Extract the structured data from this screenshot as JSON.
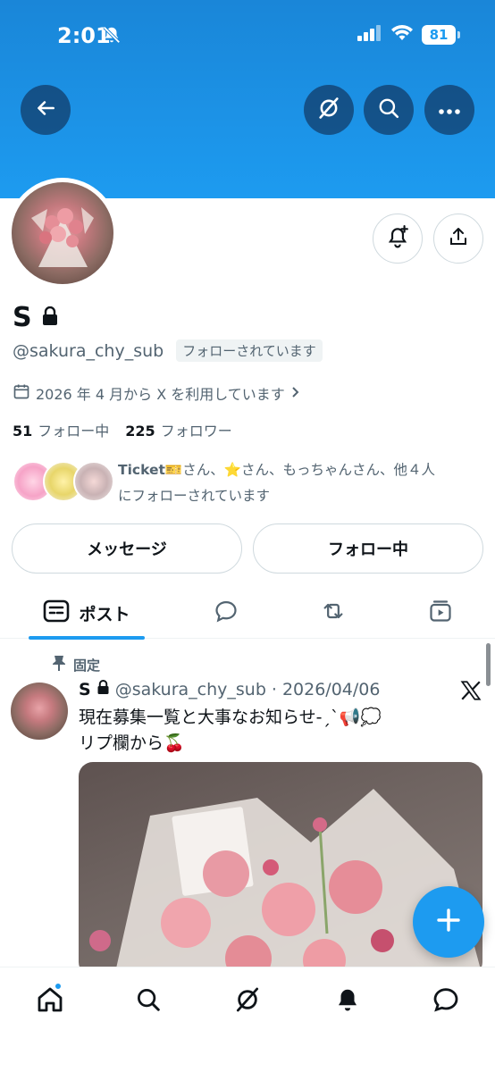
{
  "status_bar": {
    "time": "2:01",
    "battery": "81"
  },
  "profile": {
    "name": "S",
    "handle": "@sakura_chy_sub",
    "follows_you": "フォローされています",
    "joined": "2026 年 4 月から X を利用しています",
    "following_count": "51",
    "following_label": "フォロー中",
    "followers_count": "225",
    "followers_label": "フォロワー",
    "mutuals_lead": "Ticket",
    "mutuals_text_1": "さん、",
    "mutuals_text_2": "さん、もっちゃんさん、他４人",
    "mutuals_text_3": "にフォローされています"
  },
  "actions": {
    "message": "メッセージ",
    "following": "フォロー中"
  },
  "tabs": [
    {
      "label": "ポスト"
    }
  ],
  "post": {
    "pinned": "固定",
    "name": "S",
    "handle": "@sakura_chy_sub",
    "separator": "·",
    "date": "2026/04/06",
    "line1": "現在募集一覧と大事なお知らせ-ˏˋ📢💭",
    "line2": "リプ欄から🍒"
  },
  "colors": {
    "accent": "#1d9bf0",
    "text": "#0f1419",
    "muted": "#536471"
  },
  "icons": [
    "back-arrow-icon",
    "grok-icon",
    "search-icon",
    "more-icon",
    "notification-add-icon",
    "share-icon",
    "calendar-icon",
    "lock-icon",
    "pin-icon",
    "x-logo-icon",
    "plus-icon",
    "home-icon",
    "bell-icon",
    "messages-icon"
  ]
}
